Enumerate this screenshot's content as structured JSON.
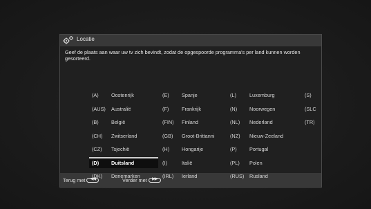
{
  "dialog": {
    "title": "Locatie",
    "description": "Geef de plaats aan waar uw tv zich bevindt, zodat de opgespoorde programma's per land kunnen worden gesorteerd.",
    "countries": [
      {
        "code": "(A)",
        "name": "Oostenrijk"
      },
      {
        "code": "(AUS)",
        "name": "Australië"
      },
      {
        "code": "(B)",
        "name": "België"
      },
      {
        "code": "(CH)",
        "name": "Zwitserland"
      },
      {
        "code": "(CZ)",
        "name": "Tsjechië"
      },
      {
        "code": "(D)",
        "name": "Duitsland"
      },
      {
        "code": "(DK)",
        "name": "Denemarken"
      },
      {
        "code": "(E)",
        "name": "Spanje"
      },
      {
        "code": "(F)",
        "name": "Frankrijk"
      },
      {
        "code": "(FIN)",
        "name": "Finland"
      },
      {
        "code": "(GB)",
        "name": "Groot-Brittanni"
      },
      {
        "code": "(H)",
        "name": "Hongarije"
      },
      {
        "code": "(I)",
        "name": "Italië"
      },
      {
        "code": "(IRL)",
        "name": "Ierland"
      },
      {
        "code": "(L)",
        "name": "Luxemburg"
      },
      {
        "code": "(N)",
        "name": "Noorwegen"
      },
      {
        "code": "(NL)",
        "name": "Nederland"
      },
      {
        "code": "(NZ)",
        "name": "Nieuw-Zeeland"
      },
      {
        "code": "(P)",
        "name": "Portugal"
      },
      {
        "code": "(PL)",
        "name": "Polen"
      },
      {
        "code": "(RUS)",
        "name": "Rusland"
      },
      {
        "code": "(S)",
        "name": ""
      },
      {
        "code": "(SLC",
        "name": ""
      },
      {
        "code": "(TR)",
        "name": ""
      }
    ],
    "selected_code": "(D)"
  },
  "footer": {
    "back_label": "Terug met",
    "back_button_glyph": "◀◀",
    "next_label": "Verder met",
    "next_button_glyph": "▶▶"
  },
  "colors": {
    "dialog_bg": "#383838",
    "inner_bg": "#202020",
    "selected_bar": "#0e0e0e",
    "selected_underline": "#cfcfcf"
  },
  "icons": {
    "title": "settings-gears-icon"
  }
}
